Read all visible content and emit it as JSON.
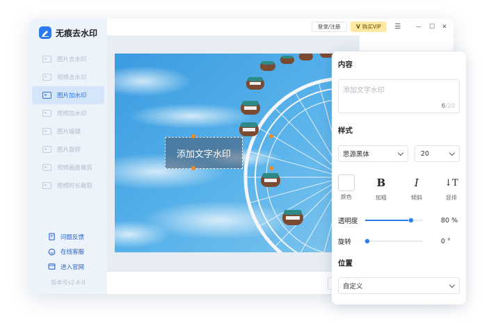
{
  "app": {
    "name": "无痕去水印",
    "version": "版本号v2.6.0"
  },
  "sidebar": {
    "items": [
      {
        "label": "图片去水印",
        "active": false
      },
      {
        "label": "视频去水印",
        "active": false
      },
      {
        "label": "图片加水印",
        "active": true
      },
      {
        "label": "视频加水印",
        "active": false
      },
      {
        "label": "图片编辑",
        "active": false
      },
      {
        "label": "图片旋转",
        "active": false
      },
      {
        "label": "视频画面裁剪",
        "active": false
      },
      {
        "label": "视频时长截取",
        "active": false
      }
    ],
    "support": [
      {
        "label": "问题反馈",
        "icon": "feedback-icon"
      },
      {
        "label": "在线客服",
        "icon": "chat-icon"
      },
      {
        "label": "进入官网",
        "icon": "website-icon"
      }
    ]
  },
  "topbar": {
    "login_label": "登录/注册",
    "vip_badge": "V",
    "vip_label": "购买VIP",
    "menu_glyph": "☰",
    "min_glyph": "—",
    "max_glyph": "☐",
    "close_glyph": "✕"
  },
  "canvas": {
    "watermark_text": "添加文字水印"
  },
  "panel": {
    "collapse_glyph": "‹",
    "content_title": "内容",
    "content_placeholder": "添加文字水印",
    "char_count": "6",
    "char_max": "/20",
    "style_title": "样式",
    "font_family": "思源黑体",
    "font_size": "20",
    "tools": [
      {
        "glyph": "",
        "label": "颜色"
      },
      {
        "glyph": "B",
        "label": "加粗"
      },
      {
        "glyph": "I",
        "label": "倾斜"
      },
      {
        "glyph": "↓T",
        "label": "竖排"
      }
    ],
    "opacity_label": "透明度",
    "opacity_value": 80,
    "opacity_text": "80 %",
    "rotate_label": "旋转",
    "rotate_value": 0,
    "rotate_text": "0 °",
    "position_title": "位置",
    "position_value": "自定义"
  },
  "colors": {
    "accent": "#2b7cf0",
    "handle": "#f08a24",
    "vip": "#ffe8a0"
  }
}
